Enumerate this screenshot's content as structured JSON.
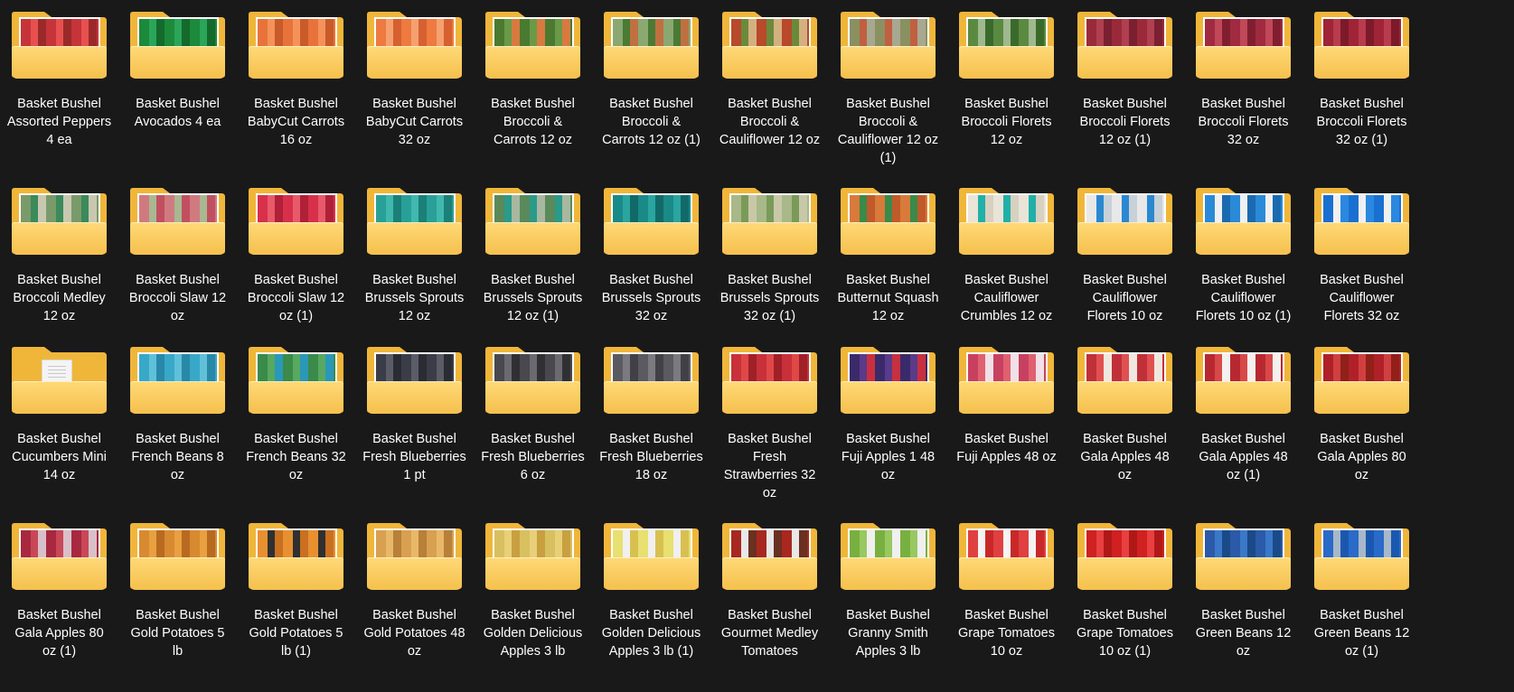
{
  "items": [
    {
      "label": "Basket  Bushel\nAssorted Peppers\n4 ea",
      "thumb": [
        "#c6343a",
        "#e85050",
        "#9a2a2a"
      ]
    },
    {
      "label": "Basket  Bushel\nAvocados 4 ea",
      "thumb": [
        "#1c8a3a",
        "#2aa55a",
        "#136a2c"
      ]
    },
    {
      "label": "Basket  Bushel\nBabyCut Carrots\n16 oz",
      "thumb": [
        "#e8733a",
        "#f4925a",
        "#c95a2a"
      ]
    },
    {
      "label": "Basket  Bushel\nBabyCut Carrots\n32 oz",
      "thumb": [
        "#ee7a40",
        "#f6a070",
        "#d66030"
      ]
    },
    {
      "label": "Basket  Bushel\nBroccoli &\nCarrots 12 oz",
      "thumb": [
        "#4a7a30",
        "#6a9a48",
        "#d87a40"
      ]
    },
    {
      "label": "Basket  Bushel\nBroccoli &\nCarrots 12 oz (1)",
      "thumb": [
        "#8aa870",
        "#4a7a34",
        "#c07040"
      ]
    },
    {
      "label": "Basket  Bushel\nBroccoli &\nCauliflower 12 oz",
      "thumb": [
        "#b8492a",
        "#6a8a3a",
        "#d4b080"
      ]
    },
    {
      "label": "Basket  Bushel\nBroccoli &\nCauliflower 12 oz\n(1)",
      "thumb": [
        "#8a9060",
        "#c06040",
        "#a8a890"
      ]
    },
    {
      "label": "Basket  Bushel\nBroccoli Florets\n12 oz",
      "thumb": [
        "#5a8a40",
        "#a0b890",
        "#3a6a2a"
      ]
    },
    {
      "label": "Basket  Bushel\nBroccoli Florets\n12 oz (1)",
      "thumb": [
        "#9a2a3a",
        "#b04050",
        "#7a2030"
      ]
    },
    {
      "label": "Basket  Bushel\nBroccoli Florets\n32 oz",
      "thumb": [
        "#a02a40",
        "#c04858",
        "#801e30"
      ]
    },
    {
      "label": "Basket  Bushel\nBroccoli Florets\n32 oz (1)",
      "thumb": [
        "#9e2436",
        "#b83c4e",
        "#7c1a2a"
      ]
    },
    {
      "label": "Basket  Bushel\nBroccoli Medley\n12 oz",
      "thumb": [
        "#7a9a6a",
        "#3a8a5a",
        "#c8c8b0"
      ]
    },
    {
      "label": "Basket  Bushel\nBroccoli Slaw 12\noz",
      "thumb": [
        "#d07a80",
        "#a8b890",
        "#c05060"
      ]
    },
    {
      "label": "Basket  Bushel\nBroccoli Slaw 12\noz (1)",
      "thumb": [
        "#d8304a",
        "#e85a6a",
        "#b02038"
      ]
    },
    {
      "label": "Basket  Bushel\nBrussels Sprouts\n12 oz",
      "thumb": [
        "#28a098",
        "#40b8ae",
        "#1a8078"
      ]
    },
    {
      "label": "Basket  Bushel\nBrussels Sprouts\n12 oz (1)",
      "thumb": [
        "#5a8a5a",
        "#2a9a8a",
        "#a8b8a0"
      ]
    },
    {
      "label": "Basket  Bushel\nBrussels Sprouts\n32 oz",
      "thumb": [
        "#1a8a88",
        "#2aa5a0",
        "#126a68"
      ]
    },
    {
      "label": "Basket  Bushel\nBrussels Sprouts\n32 oz (1)",
      "thumb": [
        "#a8b888",
        "#7a9a5a",
        "#c8c8a8"
      ]
    },
    {
      "label": "Basket  Bushel\nButternut Squash\n12 oz",
      "thumb": [
        "#d87a3a",
        "#3a8a4a",
        "#c05a2a"
      ]
    },
    {
      "label": "Basket  Bushel\nCauliflower\nCrumbles 12 oz",
      "thumb": [
        "#e8e4d8",
        "#20b0a8",
        "#d8d0c0"
      ]
    },
    {
      "label": "Basket  Bushel\nCauliflower\nFlorets 10 oz",
      "thumb": [
        "#e8e8e8",
        "#2a88d0",
        "#c8d0d8"
      ]
    },
    {
      "label": "Basket  Bushel\nCauliflower\nFlorets 10 oz (1)",
      "thumb": [
        "#2a8ad8",
        "#f0f0f0",
        "#1a6ab0"
      ]
    },
    {
      "label": "Basket  Bushel\nCauliflower\nFlorets 32 oz",
      "thumb": [
        "#1a70d0",
        "#f0f0f0",
        "#2a88e0"
      ]
    },
    {
      "label": "Basket  Bushel\nCucumbers Mini\n14 oz",
      "doc": true
    },
    {
      "label": "Basket  Bushel\nFrench Beans 8\noz",
      "thumb": [
        "#38a8c8",
        "#60c0d8",
        "#2888a8"
      ]
    },
    {
      "label": "Basket  Bushel\nFrench Beans 32\noz",
      "thumb": [
        "#3a8a4a",
        "#58a860",
        "#2a98b8"
      ]
    },
    {
      "label": "Basket  Bushel\nFresh Blueberries\n1 pt",
      "thumb": [
        "#3a3d48",
        "#5a5d68",
        "#2a2c34"
      ]
    },
    {
      "label": "Basket  Bushel\nFresh Blueberries\n6 oz",
      "thumb": [
        "#48484e",
        "#6a6a70",
        "#303034"
      ]
    },
    {
      "label": "Basket  Bushel\nFresh Blueberries\n18 oz",
      "thumb": [
        "#5a5a60",
        "#7a7a80",
        "#404046"
      ]
    },
    {
      "label": "Basket  Bushel\nFresh\nStrawberries 32\noz",
      "thumb": [
        "#c8303a",
        "#e04848",
        "#a02028"
      ]
    },
    {
      "label": "Basket  Bushel\nFuji Apples 1 48\noz",
      "thumb": [
        "#3a2a6a",
        "#5a3a8a",
        "#c83040"
      ]
    },
    {
      "label": "Basket  Bushel\nFuji Apples 48 oz",
      "thumb": [
        "#c84060",
        "#e06070",
        "#f0e0e8"
      ]
    },
    {
      "label": "Basket  Bushel\nGala Apples 48\noz",
      "thumb": [
        "#c03038",
        "#e05050",
        "#f0e8e0"
      ]
    },
    {
      "label": "Basket  Bushel\nGala Apples 48\noz (1)",
      "thumb": [
        "#b82830",
        "#d84848",
        "#f4f0ee"
      ]
    },
    {
      "label": "Basket  Bushel\nGala Apples 80\noz",
      "thumb": [
        "#b02028",
        "#d04040",
        "#902018"
      ]
    },
    {
      "label": "Basket  Bushel\nGala Apples 80\noz (1)",
      "thumb": [
        "#a82840",
        "#c84858",
        "#d8c0c8"
      ]
    },
    {
      "label": "Basket  Bushel\nGold Potatoes 5\nlb",
      "thumb": [
        "#d88a30",
        "#e8a040",
        "#b86a20"
      ]
    },
    {
      "label": "Basket  Bushel\nGold Potatoes 5\nlb (1)",
      "thumb": [
        "#e89030",
        "#303030",
        "#c87020"
      ]
    },
    {
      "label": "Basket  Bushel\nGold Potatoes 48\noz",
      "thumb": [
        "#d8a050",
        "#e8b868",
        "#b88038"
      ]
    },
    {
      "label": "Basket  Bushel\nGolden Delicious\nApples 3 lb",
      "thumb": [
        "#d8c060",
        "#e8d078",
        "#c8a040"
      ]
    },
    {
      "label": "Basket  Bushel\nGolden Delicious\nApples 3 lb (1)",
      "thumb": [
        "#e8e070",
        "#f0f0f0",
        "#d8c050"
      ]
    },
    {
      "label": "Basket  Bushel\nGourmet Medley\nTomatoes",
      "thumb": [
        "#a82820",
        "#e8e8e8",
        "#6a3020"
      ]
    },
    {
      "label": "Basket  Bushel\nGranny Smith\nApples 3 lb",
      "thumb": [
        "#78b040",
        "#98c860",
        "#f0f0f0"
      ]
    },
    {
      "label": "Basket  Bushel\nGrape Tomatoes\n10 oz",
      "thumb": [
        "#e04040",
        "#f4f4f4",
        "#c82828"
      ]
    },
    {
      "label": "Basket  Bushel\nGrape Tomatoes\n10 oz (1)",
      "thumb": [
        "#d02020",
        "#e84040",
        "#b01818"
      ]
    },
    {
      "label": "Basket  Bushel\nGreen Beans 12\noz",
      "thumb": [
        "#2a5aa8",
        "#3a78c8",
        "#1a4a88"
      ]
    },
    {
      "label": "Basket  Bushel\nGreen Beans 12\noz (1)",
      "thumb": [
        "#2a6ac8",
        "#a8b8c8",
        "#1a58b0"
      ]
    }
  ]
}
